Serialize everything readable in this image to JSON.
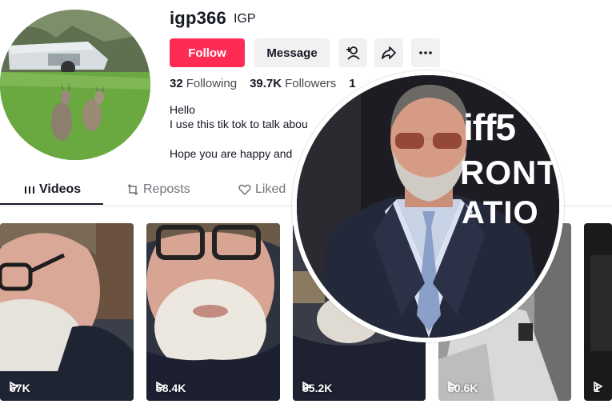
{
  "profile": {
    "username": "igp366",
    "nickname": "IGP",
    "avatar_icon": "kangaroo-photo-avatar"
  },
  "actions": {
    "follow_label": "Follow",
    "message_label": "Message",
    "add_friend_icon": "add-friend-icon",
    "share_icon": "share-icon",
    "more_icon": "more-icon"
  },
  "stats": {
    "following_count": "32",
    "following_label": "Following",
    "followers_count": "39.7K",
    "followers_label": "Followers",
    "likes_count_partial": "1"
  },
  "bio": {
    "line1": "Hello",
    "line2": "I use this tik tok to talk abou",
    "line3": "Hope you are happy and"
  },
  "tabs": [
    {
      "label": "Videos",
      "icon": "grid-icon",
      "active": true
    },
    {
      "label": "Reposts",
      "icon": "repost-icon",
      "active": false
    },
    {
      "label": "Liked",
      "icon": "heart-icon",
      "active": false
    }
  ],
  "videos": [
    {
      "views": "67K"
    },
    {
      "views": "58.4K"
    },
    {
      "views": "85.2K"
    },
    {
      "views": "50.6K"
    },
    {
      "views": "1"
    }
  ],
  "overlay": {
    "backdrop_text": [
      "iff5",
      "RONT",
      "ATIO"
    ]
  },
  "colors": {
    "follow_button": "#fe2c55",
    "secondary_button": "#f1f1f2",
    "text_primary": "#161823",
    "text_secondary": "#73747b"
  }
}
